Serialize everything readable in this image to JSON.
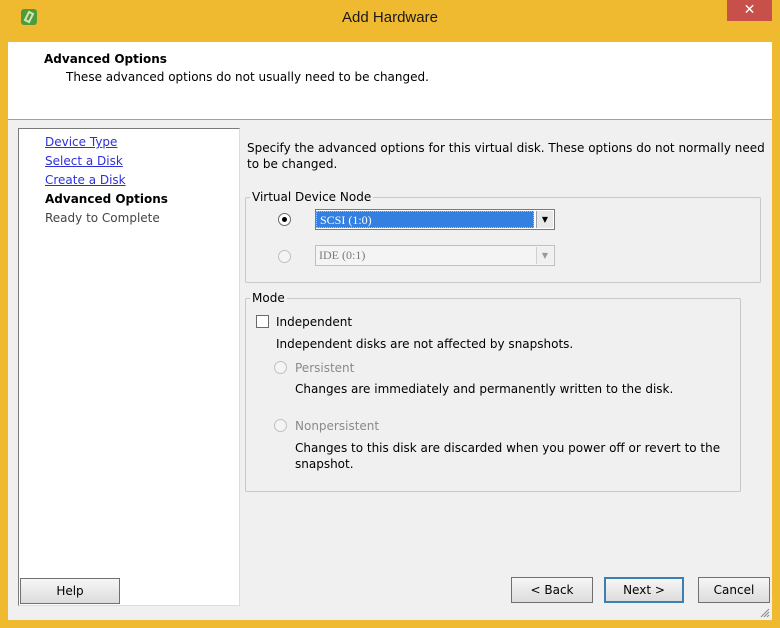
{
  "window": {
    "title": "Add Hardware",
    "close_glyph": "✕",
    "app_icon": "vsphere-app-icon"
  },
  "header": {
    "title": "Advanced Options",
    "subtitle": "These advanced options do not usually need to be changed."
  },
  "steps": [
    {
      "label": "Device Type",
      "state": "link"
    },
    {
      "label": "Select a Disk",
      "state": "link"
    },
    {
      "label": "Create a Disk",
      "state": "link"
    },
    {
      "label": "Advanced Options",
      "state": "current"
    },
    {
      "label": "Ready to Complete",
      "state": "pending"
    }
  ],
  "main": {
    "description": "Specify the advanced options for this virtual disk. These options do not normally need to be changed."
  },
  "virtual_device_node": {
    "label": "Virtual Device Node",
    "scsi_value": "SCSI (1:0)",
    "ide_value": "IDE (0:1)",
    "selected": "scsi"
  },
  "mode": {
    "label": "Mode",
    "independent_label": "Independent",
    "independent_checked": false,
    "independent_note": "Independent disks are not affected by snapshots.",
    "persistent_label": "Persistent",
    "persistent_note": "Changes are immediately and permanently written to the disk.",
    "nonpersistent_label": "Nonpersistent",
    "nonpersistent_note": "Changes to this disk are discarded when you power off or revert to the snapshot."
  },
  "buttons": {
    "help": "Help",
    "back": "< Back",
    "next": "Next >",
    "cancel": "Cancel"
  },
  "colors": {
    "title_bar": "#f0ba30",
    "close_button": "#c7504a",
    "link": "#3030d8",
    "selection": "#3380e0"
  }
}
